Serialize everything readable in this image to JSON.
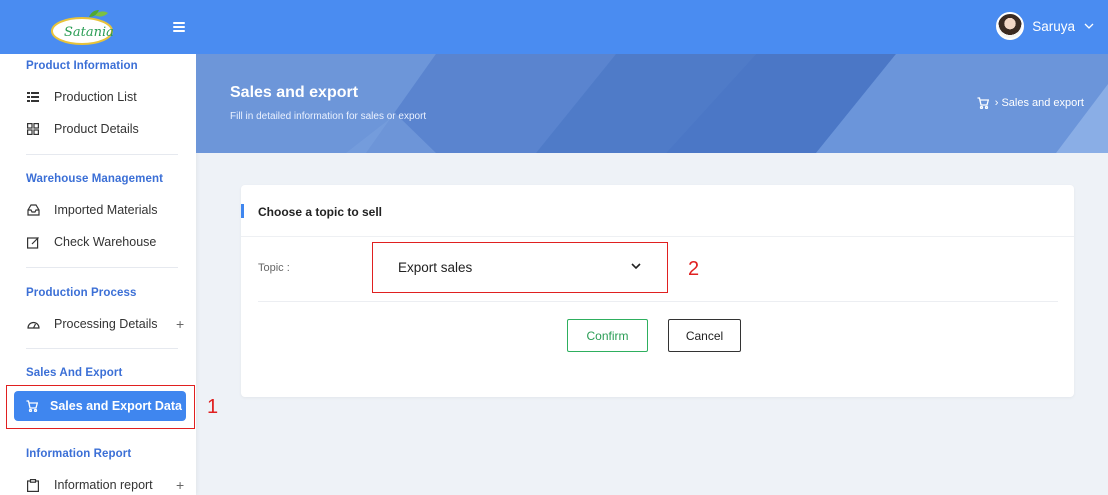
{
  "app": {
    "logo_text": "Satania",
    "accent_color": "#4a8cf1"
  },
  "sidebar": {
    "sections": [
      {
        "title": "Product Information",
        "items": [
          {
            "label": "Production List",
            "icon": "list-icon"
          },
          {
            "label": "Product Details",
            "icon": "grid-icon"
          }
        ]
      },
      {
        "title": "Warehouse Management",
        "items": [
          {
            "label": "Imported Materials",
            "icon": "inbox-icon"
          },
          {
            "label": "Check Warehouse",
            "icon": "edit-icon"
          }
        ]
      },
      {
        "title": "Production Process",
        "items": [
          {
            "label": "Processing Details",
            "icon": "gauge-icon",
            "expand": "+"
          }
        ]
      },
      {
        "title": "Sales And Export",
        "items": [
          {
            "label": "Sales and Export Data",
            "icon": "cart-icon",
            "active": true
          }
        ]
      },
      {
        "title": "Information Report",
        "items": [
          {
            "label": "Information report",
            "icon": "clipboard-icon",
            "expand": "+"
          }
        ]
      }
    ]
  },
  "user": {
    "name": "Saruya"
  },
  "banner": {
    "title": "Sales and export",
    "subtitle": "Fill in detailed information for sales or export",
    "breadcrumb": "› Sales and export"
  },
  "card": {
    "title": "Choose a topic to sell",
    "topic_label": "Topic :",
    "topic_value": "Export sales",
    "confirm_label": "Confirm",
    "cancel_label": "Cancel"
  },
  "annotations": {
    "one": "1",
    "two": "2",
    "color": "#e02020"
  }
}
